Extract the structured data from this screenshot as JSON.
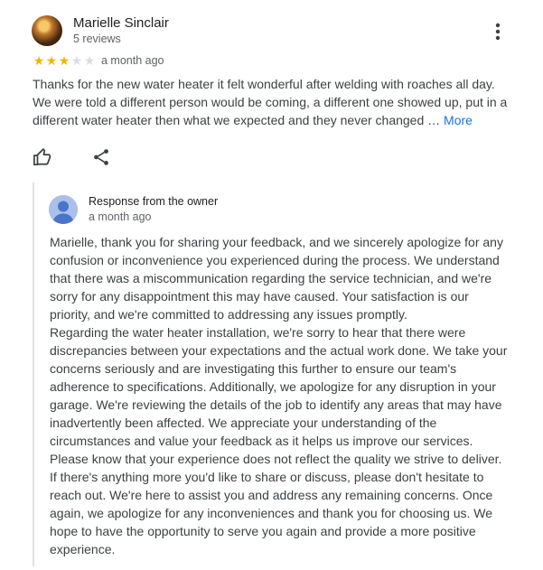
{
  "review": {
    "author_name": "Marielle Sinclair",
    "author_reviews": "5 reviews",
    "rating": 3,
    "rating_max": 5,
    "date": "a month ago",
    "text_lines": [
      "Thanks for the new water heater it felt wonderful after welding with roaches all day.",
      "We were told a different person would be coming, a different one showed up, put in a",
      "different water heater then what we expected and they never changed … "
    ],
    "more_label": "More",
    "icons": {
      "menu": "more-vert-icon",
      "like": "thumbs-up-icon",
      "share": "share-icon"
    }
  },
  "owner_response": {
    "title": "Response from the owner",
    "date": "a month ago",
    "text_lines": [
      "Marielle, thank you for sharing your feedback, and we sincerely apologize for any",
      "confusion or inconvenience you experienced during the process. We understand",
      "that there was a miscommunication regarding the service technician, and we're",
      "sorry for any disappointment this may have caused. Your satisfaction is our",
      "priority, and we're committed to addressing any issues promptly.",
      "Regarding the water heater installation, we're sorry to hear that there were",
      "discrepancies between your expectations and the actual work done. We take your",
      "concerns seriously and are investigating this further to ensure our team's",
      "adherence to specifications. Additionally, we apologize for any disruption in your",
      "garage. We're reviewing the details of the job to identify any areas that may have",
      "inadvertently been affected. We appreciate your understanding of the",
      "circumstances and value your feedback as it helps us improve our services.",
      "Please know that your experience does not reflect the quality we strive to deliver.",
      "If there's anything more you'd like to share or discuss, please don't hesitate to",
      "reach out. We're here to assist you and address any remaining concerns. Once",
      "again, we apologize for any inconveniences and thank you for choosing us. We",
      "hope to have the opportunity to serve you again and provide a more positive",
      "experience."
    ],
    "icons": {
      "avatar": "person-avatar-icon"
    }
  },
  "colors": {
    "star_filled": "#f4b400",
    "star_empty": "#dadce0",
    "link": "#1a73e8",
    "owner_avatar_bg": "#aac0ea",
    "owner_avatar_fg": "#4a74c9"
  }
}
